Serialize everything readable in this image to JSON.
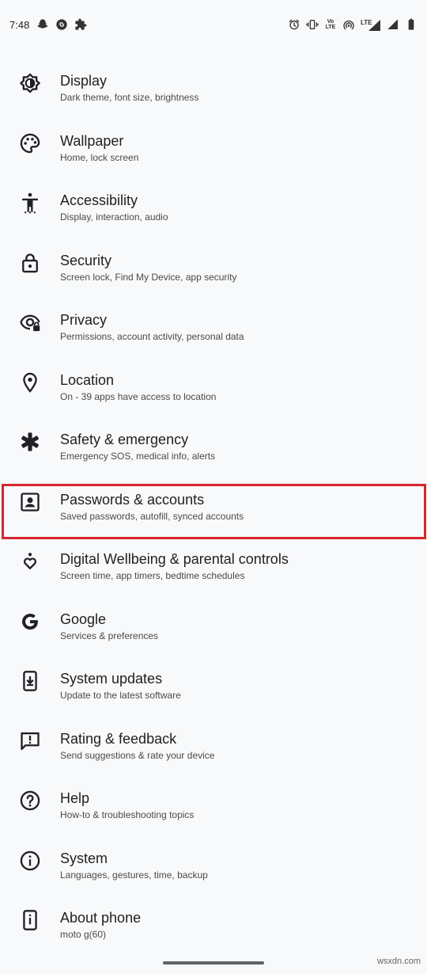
{
  "status_bar": {
    "time": "7:48",
    "left_icons": [
      "snapchat-icon",
      "shazam-icon",
      "puzzle-icon"
    ],
    "right_icons": [
      "alarm-icon",
      "vibrate-icon",
      "volte-icon",
      "hotspot-icon",
      "lte-signal-icon",
      "signal-icon",
      "battery-icon"
    ],
    "volte_text": "Vo\nLTE",
    "lte_text": "LTE"
  },
  "settings": [
    {
      "title": "Display",
      "subtitle": "Dark theme, font size, brightness",
      "icon": "display-brightness-icon"
    },
    {
      "title": "Wallpaper",
      "subtitle": "Home, lock screen",
      "icon": "palette-icon"
    },
    {
      "title": "Accessibility",
      "subtitle": "Display, interaction, audio",
      "icon": "accessibility-icon"
    },
    {
      "title": "Security",
      "subtitle": "Screen lock, Find My Device, app security",
      "icon": "lock-icon"
    },
    {
      "title": "Privacy",
      "subtitle": "Permissions, account activity, personal data",
      "icon": "privacy-eye-icon"
    },
    {
      "title": "Location",
      "subtitle": "On - 39 apps have access to location",
      "icon": "location-pin-icon"
    },
    {
      "title": "Safety & emergency",
      "subtitle": "Emergency SOS, medical info, alerts",
      "icon": "medical-asterisk-icon"
    },
    {
      "title": "Passwords & accounts",
      "subtitle": "Saved passwords, autofill, synced accounts",
      "icon": "account-box-icon",
      "highlighted": true
    },
    {
      "title": "Digital Wellbeing & parental controls",
      "subtitle": "Screen time, app timers, bedtime schedules",
      "icon": "wellbeing-heart-icon"
    },
    {
      "title": "Google",
      "subtitle": "Services & preferences",
      "icon": "google-g-icon"
    },
    {
      "title": "System updates",
      "subtitle": "Update to the latest software",
      "icon": "system-update-icon"
    },
    {
      "title": "Rating & feedback",
      "subtitle": "Send suggestions & rate your device",
      "icon": "feedback-icon"
    },
    {
      "title": "Help",
      "subtitle": "How-to & troubleshooting topics",
      "icon": "help-icon"
    },
    {
      "title": "System",
      "subtitle": "Languages, gestures, time, backup",
      "icon": "info-icon"
    },
    {
      "title": "About phone",
      "subtitle": "moto g(60)",
      "icon": "phone-info-icon"
    }
  ],
  "colors": {
    "background": "#f8f9fa",
    "highlight": "#d7262e",
    "text_primary": "#1f1f1f",
    "text_secondary": "#4a4a4a"
  },
  "watermark": "wsxdn.com"
}
